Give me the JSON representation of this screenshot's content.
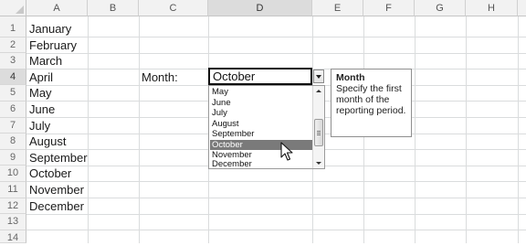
{
  "columns": [
    "A",
    "B",
    "C",
    "D",
    "E",
    "F",
    "G",
    "H"
  ],
  "active_column": "D",
  "rows": [
    "1",
    "2",
    "3",
    "4",
    "5",
    "6",
    "7",
    "8",
    "9",
    "10",
    "11",
    "12",
    "13",
    "14"
  ],
  "active_row": "4",
  "column_a": [
    "January",
    "February",
    "March",
    "April",
    "May",
    "June",
    "July",
    "August",
    "September",
    "October",
    "November",
    "December"
  ],
  "label_cell": "Month:",
  "combo": {
    "value": "October",
    "options": [
      "May",
      "June",
      "July",
      "August",
      "September",
      "October",
      "November",
      "December"
    ],
    "selected": "October"
  },
  "tooltip": {
    "title": "Month",
    "body": [
      "Specify the first",
      "month of the",
      "reporting period."
    ]
  },
  "icons": {
    "corner": "select-all-triangle-icon",
    "dropdown": "chevron-down-icon",
    "cursor": "mouse-pointer-icon"
  }
}
